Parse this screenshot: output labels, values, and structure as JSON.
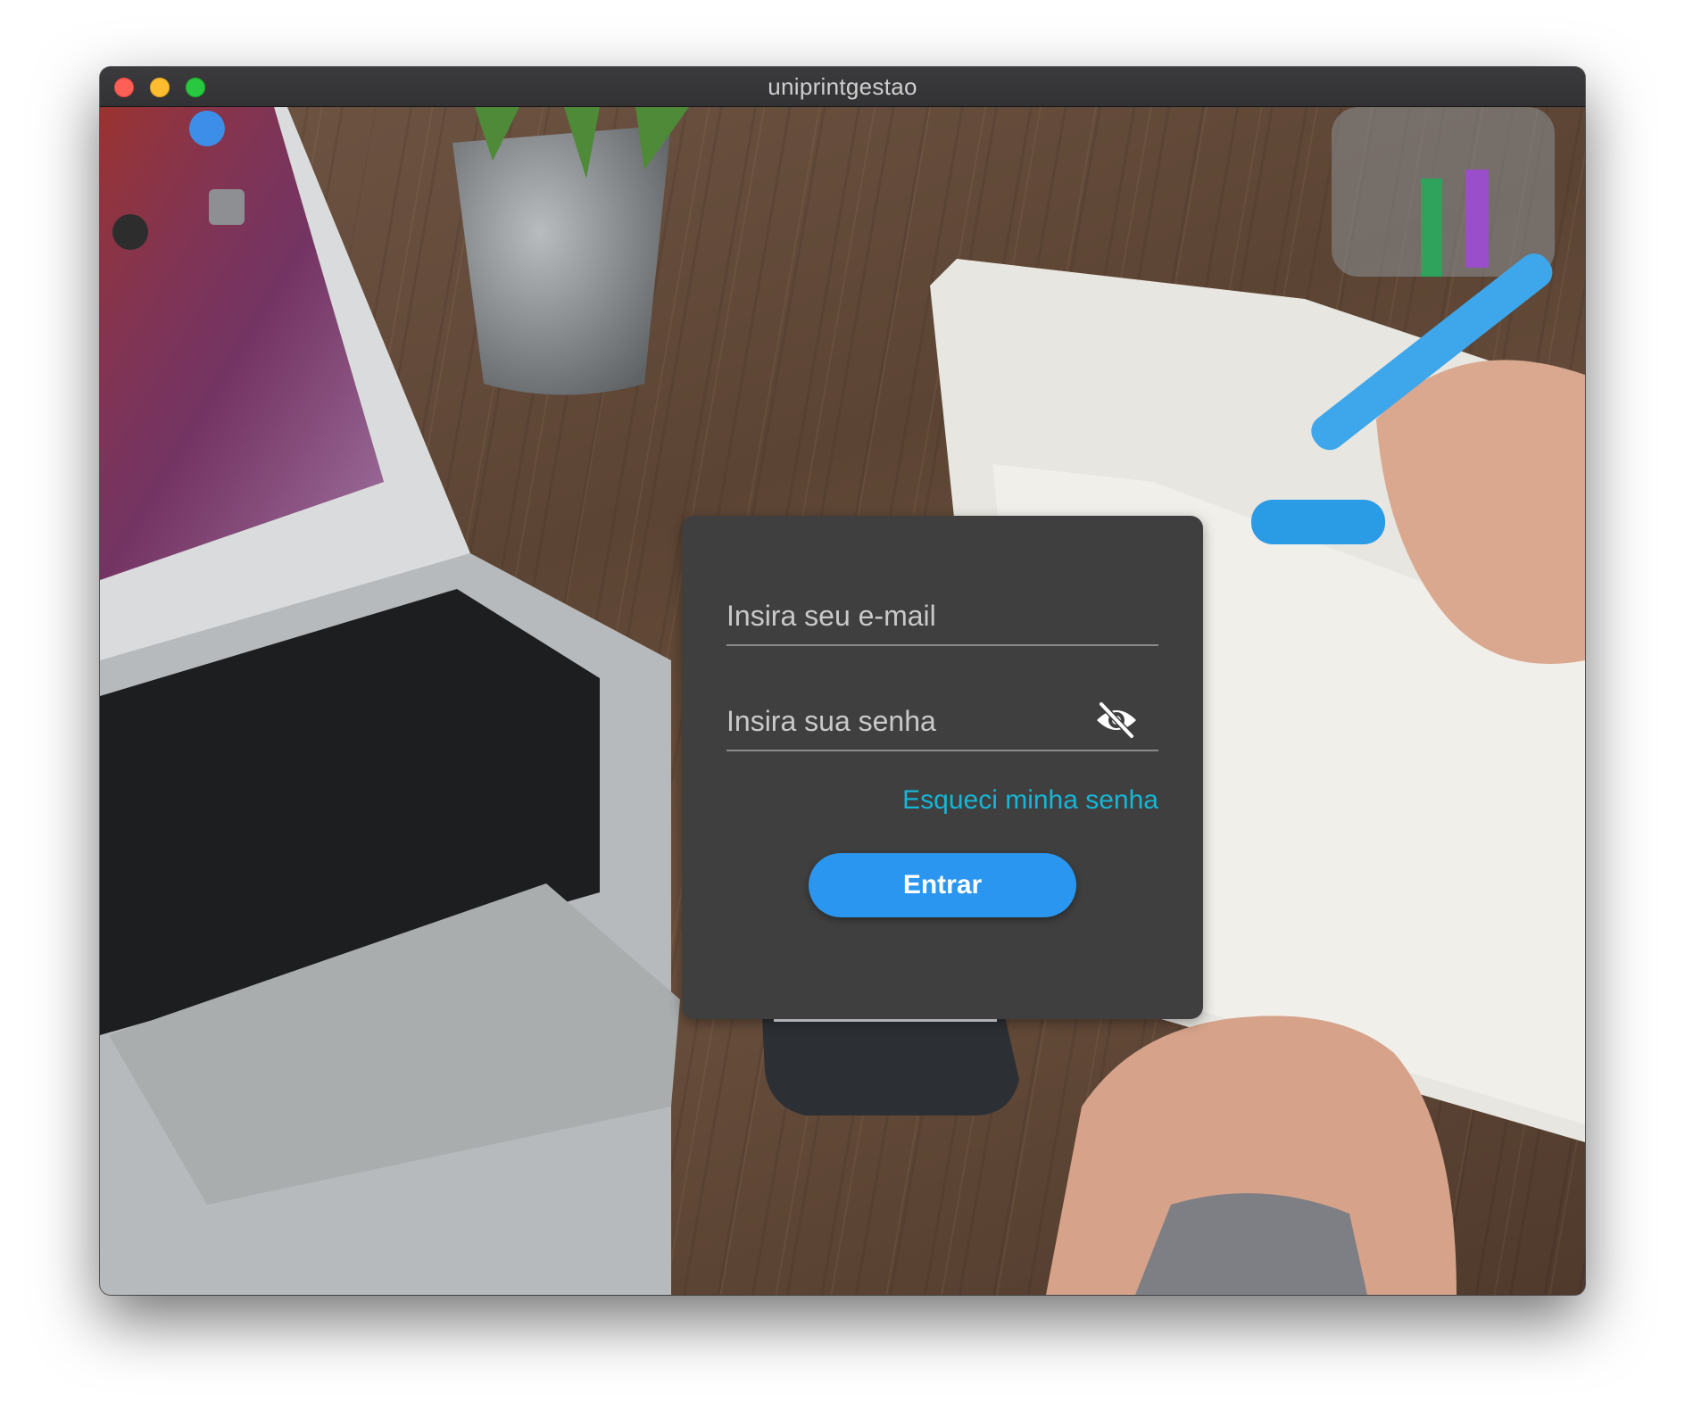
{
  "window": {
    "title": "uniprintgestao"
  },
  "login": {
    "email_placeholder": "Insira seu e-mail",
    "email_value": "",
    "password_placeholder": "Insira sua senha",
    "password_value": "",
    "forgot_password_label": "Esqueci minha senha",
    "submit_label": "Entrar"
  },
  "icons": {
    "password_toggle": "eye-off-icon"
  },
  "colors": {
    "card_background": "#3f3f3f",
    "link": "#16b6d6",
    "primary_button": "#2a96ef",
    "titlebar": "#353537"
  }
}
